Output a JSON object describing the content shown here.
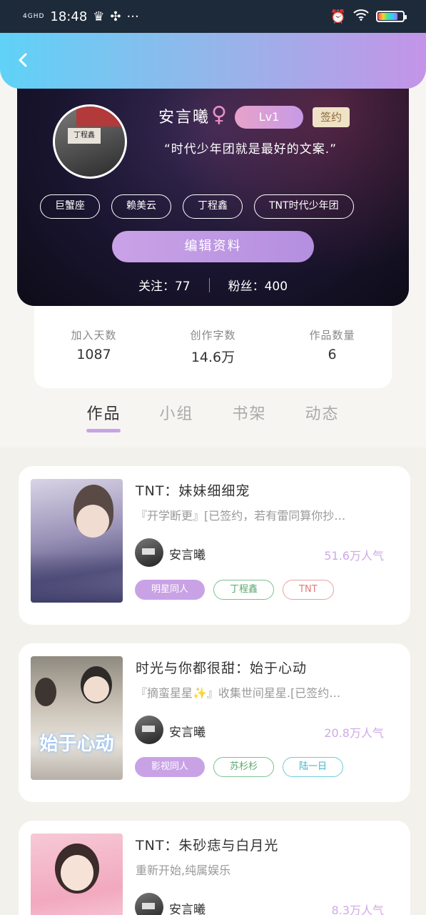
{
  "status": {
    "network": "4GHD",
    "time": "18:48",
    "more": "···"
  },
  "profile": {
    "username": "安言曦",
    "gender_symbol": "♀",
    "level": "Lv1",
    "signed": "签约",
    "motto": "“时代少年团就是最好的文案.”",
    "avatar_tag": "丁程鑫",
    "chips": [
      "巨蟹座",
      "赖美云",
      "丁程鑫",
      "TNT时代少年团"
    ],
    "edit_label": "编辑资料",
    "following_label": "关注：",
    "following": "77",
    "fans_label": "粉丝：",
    "fans": "400"
  },
  "stats": [
    {
      "label": "加入天数",
      "value": "1087"
    },
    {
      "label": "创作字数",
      "value": "14.6万"
    },
    {
      "label": "作品数量",
      "value": "6"
    }
  ],
  "tabs": [
    "作品",
    "小组",
    "书架",
    "动态"
  ],
  "books": [
    {
      "title": "TNT：妹妹细细宠",
      "desc": "『开学断更』[已签约，若有雷同算你抄…",
      "author": "安言曦",
      "popularity": "51.6万人气",
      "tags": [
        "明星同人",
        "丁程鑫",
        "TNT"
      ]
    },
    {
      "title": "时光与你都很甜：始于心动",
      "desc": "『摘蛮星星✨』收集世间星星.[已签约…",
      "author": "安言曦",
      "popularity": "20.8万人气",
      "cover_text": "始于心动",
      "tags": [
        "影视同人",
        "苏杉杉",
        "陆一日"
      ]
    },
    {
      "title": "TNT：朱砂痣与白月光",
      "desc": "重新开始,纯属娱乐",
      "author": "安言曦",
      "popularity": "8.3万人气",
      "tags": []
    }
  ]
}
